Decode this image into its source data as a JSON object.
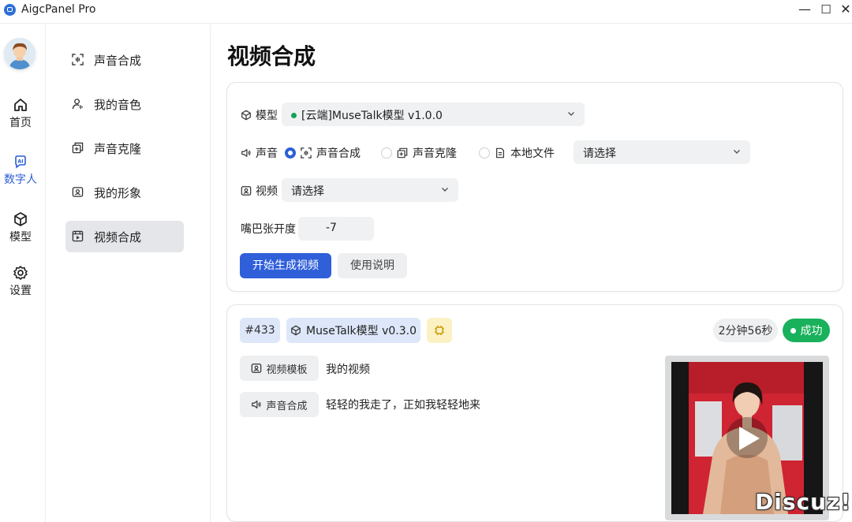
{
  "app": {
    "title": "AigcPanel Pro",
    "window_controls": {
      "minimize": "—",
      "maximize": "☐",
      "close": "✕"
    }
  },
  "rail": {
    "items": [
      {
        "label": "首页",
        "icon": "home-icon",
        "active": false
      },
      {
        "label": "数字人",
        "icon": "ai-icon",
        "active": true
      },
      {
        "label": "模型",
        "icon": "cube-icon",
        "active": false
      },
      {
        "label": "设置",
        "icon": "gear-icon",
        "active": false
      }
    ]
  },
  "subnav": {
    "items": [
      {
        "label": "声音合成",
        "icon": "scan-voice-icon",
        "active": false
      },
      {
        "label": "我的音色",
        "icon": "user-voice-icon",
        "active": false
      },
      {
        "label": "声音克隆",
        "icon": "clone-icon",
        "active": false
      },
      {
        "label": "我的形象",
        "icon": "image-icon",
        "active": false
      },
      {
        "label": "视频合成",
        "icon": "video-icon",
        "active": true
      }
    ]
  },
  "page": {
    "title": "视频合成"
  },
  "form": {
    "model_label": "模型",
    "model_value": "[云端]MuseTalk模型 v1.0.0",
    "voice_label": "声音",
    "voice_options": [
      {
        "label": "声音合成",
        "checked": true
      },
      {
        "label": "声音克隆",
        "checked": false
      },
      {
        "label": "本地文件",
        "checked": false
      }
    ],
    "voice_select_placeholder": "请选择",
    "video_label": "视频",
    "video_select_placeholder": "请选择",
    "mouth_label": "嘴巴张开度",
    "mouth_value": "-7",
    "start_button": "开始生成视频",
    "help_button": "使用说明"
  },
  "task": {
    "id": "#433",
    "model": "MuseTalk模型 v0.3.0",
    "duration": "2分钟56秒",
    "status": "成功",
    "rows": [
      {
        "key": "视频模板",
        "value": "我的视频"
      },
      {
        "key": "声音合成",
        "value": "轻轻的我走了，正如我轻轻地来"
      }
    ]
  },
  "watermark": "Discuz!",
  "colors": {
    "accent": "#2f5fd9",
    "success": "#19b15b",
    "tag_blue": "#dde7f9",
    "tag_yellow": "#fbf1c4"
  }
}
